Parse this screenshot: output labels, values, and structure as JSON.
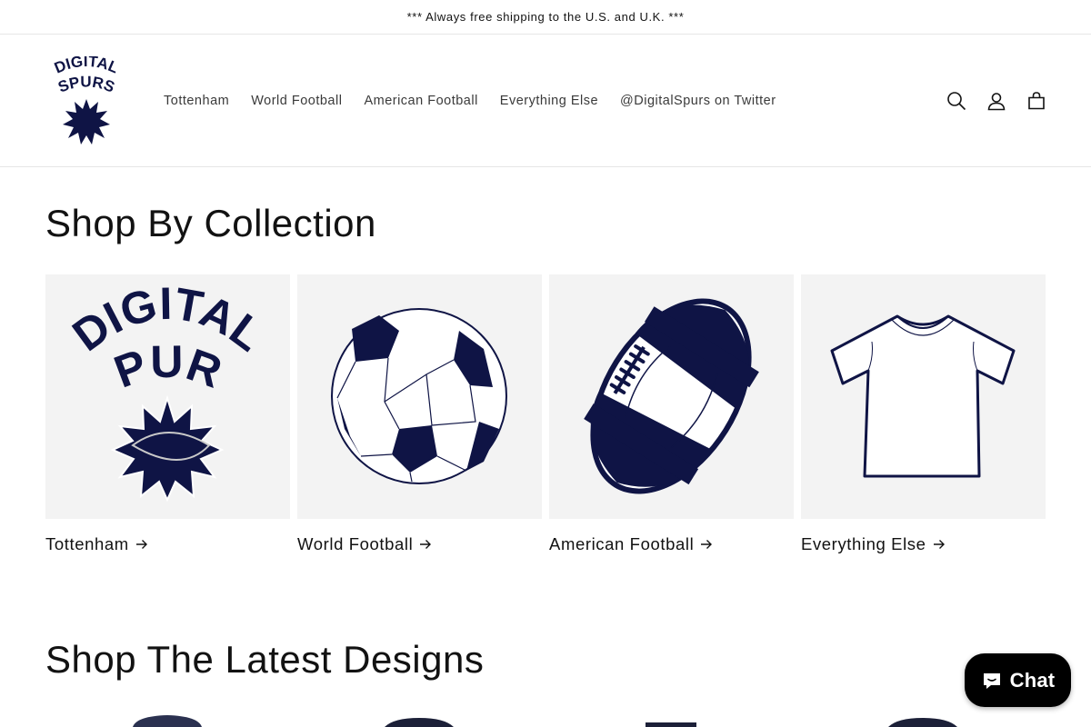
{
  "announcement": "*** Always free shipping to the U.S. and U.K. ***",
  "logo": {
    "line1": "DIGITAL",
    "line2": "SPURS"
  },
  "nav": [
    "Tottenham",
    "World Football",
    "American Football",
    "Everything Else",
    "@DigitalSpurs on Twitter"
  ],
  "header_icons": [
    "search-icon",
    "account-icon",
    "cart-icon"
  ],
  "collections_title": "Shop By Collection",
  "collections": [
    {
      "label": "Tottenham",
      "image": "digital-spurs-logo"
    },
    {
      "label": "World Football",
      "image": "soccer-ball"
    },
    {
      "label": "American Football",
      "image": "american-football"
    },
    {
      "label": "Everything Else",
      "image": "t-shirt"
    }
  ],
  "latest_title": "Shop The Latest Designs",
  "chat_label": "Chat",
  "colors": {
    "navy": "#0f1445",
    "card_bg": "#f3f3f3",
    "chat_bg": "#000000"
  }
}
